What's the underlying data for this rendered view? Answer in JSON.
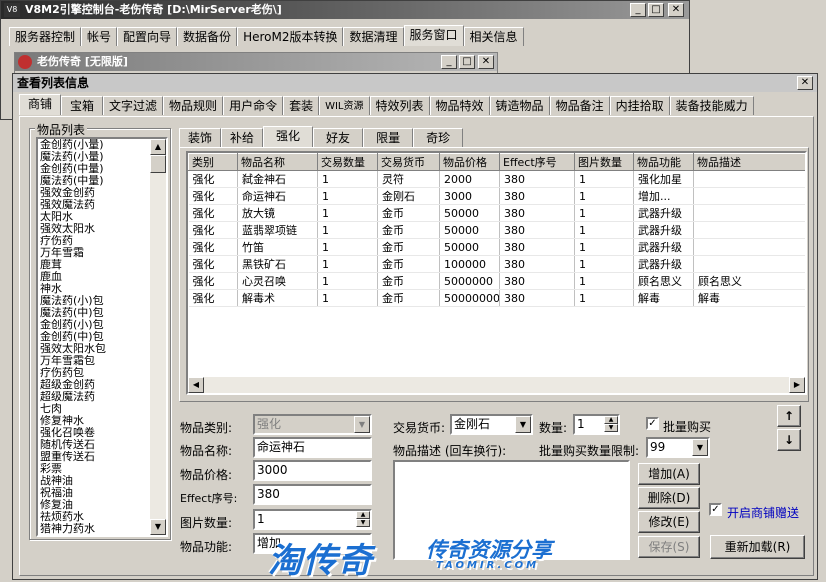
{
  "main_window": {
    "title": "V8M2引擎控制台-老伤传奇 [D:\\MirServer老伤\\]",
    "tabs": [
      "服务器控制",
      "帐号",
      "配置向导",
      "数据备份",
      "HeroM2版本转换",
      "数据清理",
      "服务窗口",
      "相关信息"
    ],
    "active_tab": "服务窗口"
  },
  "sub_window": {
    "title": "老伤传奇 [无限版]"
  },
  "dialog": {
    "title": "查看列表信息",
    "tabs": [
      "商铺",
      "宝箱",
      "文字过滤",
      "物品规则",
      "用户命令",
      "套装",
      "WIL资源",
      "特效列表",
      "物品特效",
      "铸造物品",
      "物品备注",
      "内挂拾取",
      "装备技能威力"
    ],
    "active_tab": "商铺",
    "item_list": {
      "label": "物品列表",
      "items": [
        "金创药(小量)",
        "魔法药(小量)",
        "金创药(中量)",
        "魔法药(中量)",
        "强效金创药",
        "强效魔法药",
        "太阳水",
        "强效太阳水",
        "疗伤药",
        "万年雪霜",
        "鹿茸",
        "鹿血",
        "神水",
        "魔法药(小)包",
        "魔法药(中)包",
        "金创药(小)包",
        "金创药(中)包",
        "强效太阳水包",
        "万年雪霜包",
        "疗伤药包",
        "超级金创药",
        "超级魔法药",
        "七肉",
        "修复神水",
        "强化召唤卷",
        "随机传送石",
        "盟重传送石",
        "彩票",
        "战神油",
        "祝福油",
        "修复油",
        "祛烦药水",
        "猎神力药水"
      ]
    },
    "category_tabs": [
      "装饰",
      "补给",
      "强化",
      "好友",
      "限量",
      "奇珍"
    ],
    "active_category": "强化",
    "table": {
      "columns": [
        "类别",
        "物品名称",
        "交易数量",
        "交易货币",
        "物品价格",
        "Effect序号",
        "图片数量",
        "物品功能",
        "物品描述"
      ],
      "rows": [
        [
          "强化",
          "弑金神石",
          "1",
          "灵符",
          "2000",
          "380",
          "1",
          "强化加星",
          ""
        ],
        [
          "强化",
          "命运神石",
          "1",
          "金刚石",
          "3000",
          "380",
          "1",
          "增加...",
          ""
        ],
        [
          "强化",
          "放大镜",
          "1",
          "金币",
          "50000",
          "380",
          "1",
          "武器升级",
          ""
        ],
        [
          "强化",
          "蓝翡翠项链",
          "1",
          "金币",
          "50000",
          "380",
          "1",
          "武器升级",
          ""
        ],
        [
          "强化",
          "竹笛",
          "1",
          "金币",
          "50000",
          "380",
          "1",
          "武器升级",
          ""
        ],
        [
          "强化",
          "黑铁矿石",
          "1",
          "金币",
          "100000",
          "380",
          "1",
          "武器升级",
          ""
        ],
        [
          "强化",
          "心灵召唤",
          "1",
          "金币",
          "5000000",
          "380",
          "1",
          "顾名思义",
          "顾名思义"
        ],
        [
          "强化",
          "解毒术",
          "1",
          "金币",
          "50000000",
          "380",
          "1",
          "解毒",
          "解毒"
        ]
      ],
      "selected_row": 1
    },
    "form": {
      "category_label": "物品类别:",
      "category_value": "强化",
      "name_label": "物品名称:",
      "name_value": "命运神石",
      "price_label": "物品价格:",
      "price_value": "3000",
      "effect_label": "Effect序号:",
      "effect_value": "380",
      "image_count_label": "图片数量:",
      "image_count_value": "1",
      "function_label": "物品功能:",
      "function_value": "增加...",
      "currency_label": "交易货币:",
      "currency_value": "金刚石",
      "quantity_label": "数量:",
      "quantity_value": "1",
      "batch_buy_label": "批量购买",
      "batch_buy_checked": true,
      "description_label": "物品描述 (回车换行):",
      "batch_limit_label": "批量购买数量限制:",
      "batch_limit_value": "99",
      "description_value": "",
      "shop_gift_label": "开启商铺赠送",
      "shop_gift_checked": true
    },
    "buttons": {
      "add": "增加(A)",
      "delete": "删除(D)",
      "edit": "修改(E)",
      "save": "保存(S)",
      "reload": "重新加载(R)",
      "move_up": "↑",
      "move_down": "↓"
    }
  },
  "watermark": {
    "brand": "淘传奇",
    "tagline": "传奇资源分享",
    "url": "TAOMIR.COM"
  }
}
